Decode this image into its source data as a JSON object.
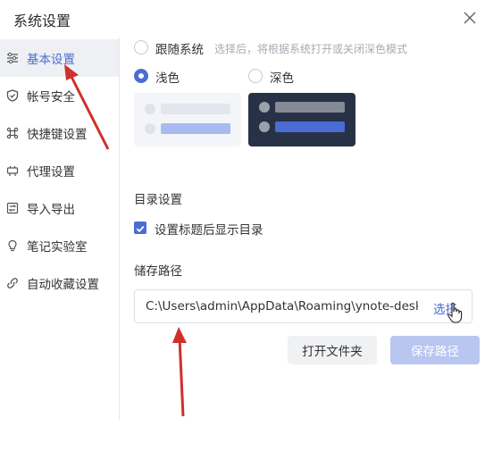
{
  "window": {
    "title": "系统设置"
  },
  "sidebar": {
    "items": [
      {
        "label": "基本设置",
        "icon": "sliders-icon",
        "active": true
      },
      {
        "label": "帐号安全",
        "icon": "shield-icon",
        "active": false
      },
      {
        "label": "快捷键设置",
        "icon": "command-key-icon",
        "active": false
      },
      {
        "label": "代理设置",
        "icon": "plug-icon",
        "active": false
      },
      {
        "label": "导入导出",
        "icon": "import-export-icon",
        "active": false
      },
      {
        "label": "笔记实验室",
        "icon": "lightbulb-icon",
        "active": false
      },
      {
        "label": "自动收藏设置",
        "icon": "link-icon",
        "active": false
      }
    ]
  },
  "theme": {
    "follow_system_label": "跟随系统",
    "follow_system_hint": "选择后，将根据系统打开或关闭深色模式",
    "light_label": "浅色",
    "dark_label": "深色",
    "selected": "light"
  },
  "directory": {
    "section_title": "目录设置",
    "show_toc_label": "设置标题后显示目录",
    "show_toc_checked": true
  },
  "storage": {
    "section_title": "储存路径",
    "path_value": "C:\\Users\\admin\\AppData\\Roaming\\ynote-desktop",
    "choose_label": "选择",
    "open_folder_label": "打开文件夹",
    "save_path_label": "保存路径"
  },
  "colors": {
    "accent": "#4a6cd4",
    "active_nav_bg": "#eef0f4",
    "dark_card": "#283246",
    "save_disabled": "#b8c6f0",
    "annotation_arrow": "#d0302b"
  }
}
